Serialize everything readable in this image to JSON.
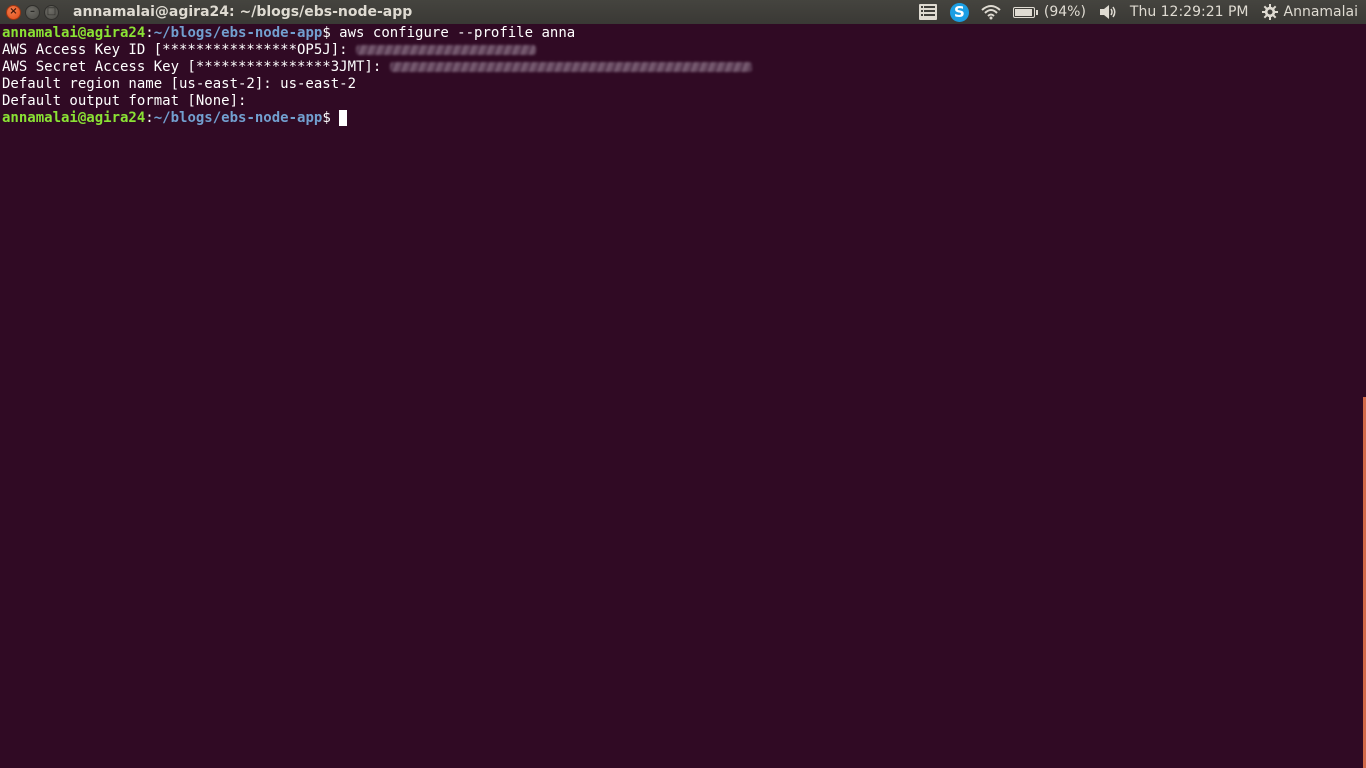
{
  "window": {
    "title": "annamalai@agira24: ~/blogs/ebs-node-app",
    "buttons": {
      "close": "×",
      "minimize": "–",
      "maximize": "□"
    }
  },
  "panel": {
    "icons": [
      "menu-list-icon",
      "skype-icon",
      "wifi-icon",
      "battery-icon",
      "volume-icon",
      "gear-icon"
    ],
    "skype_letter": "S",
    "battery_text": "(94%)",
    "battery_level": 0.94,
    "clock": "Thu 12:29:21 PM",
    "user": "Annamalai"
  },
  "terminal": {
    "background": "#300a24",
    "prompt": {
      "user": "annamalai@agira24",
      "sep": ":",
      "path": "~/blogs/ebs-node-app",
      "symbol": "$ "
    },
    "command": "aws configure --profile anna",
    "lines": {
      "access_key_label": "AWS Access Key ID [****************OP5J]: ",
      "secret_key_label": "AWS Secret Access Key [****************3JMT]: ",
      "region": "Default region name [us-east-2]: us-east-2",
      "output_format": "Default output format [None]:"
    }
  }
}
